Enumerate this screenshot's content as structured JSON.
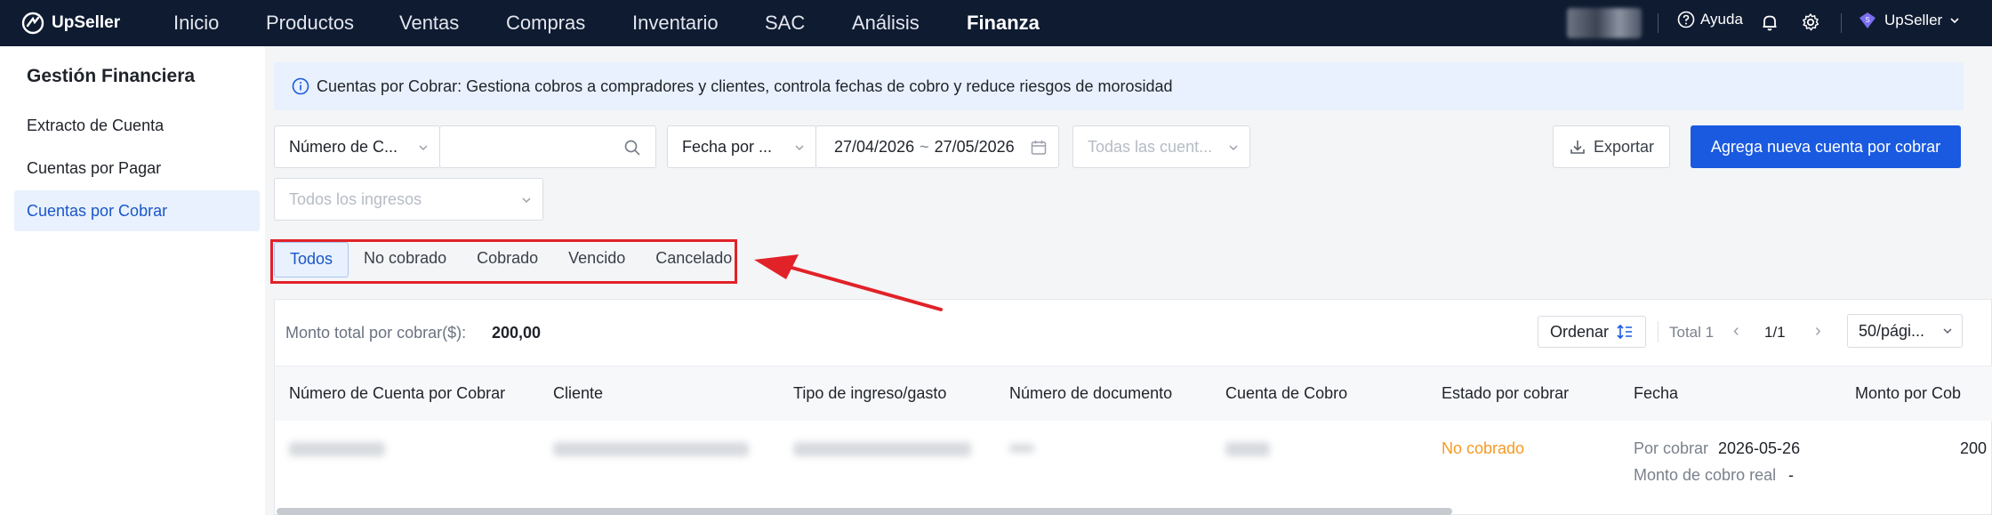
{
  "app": {
    "name": "UpSeller"
  },
  "nav": {
    "items": [
      "Inicio",
      "Productos",
      "Ventas",
      "Compras",
      "Inventario",
      "SAC",
      "Análisis",
      "Finanza"
    ],
    "active": "Finanza",
    "help_label": "Ayuda",
    "user_label": "UpSeller"
  },
  "sidebar": {
    "title": "Gestión Financiera",
    "items": [
      "Extracto de Cuenta",
      "Cuentas por Pagar",
      "Cuentas por Cobrar"
    ],
    "active": "Cuentas por Cobrar"
  },
  "banner": {
    "text": "Cuentas por Cobrar: Gestiona cobros a compradores y clientes, controla fechas de cobro y reduce riesgos de morosidad"
  },
  "filters": {
    "search_type": "Número de C...",
    "search_value": "",
    "date_type": "Fecha por ...",
    "date_start": "27/04/2026",
    "date_sep": "~",
    "date_end": "27/05/2026",
    "accounts_placeholder": "Todas las cuent...",
    "income_placeholder": "Todos los ingresos"
  },
  "actions": {
    "export": "Exportar",
    "add": "Agrega nueva cuenta por cobrar"
  },
  "tabs": [
    "Todos",
    "No cobrado",
    "Cobrado",
    "Vencido",
    "Cancelado"
  ],
  "tabs_active": "Todos",
  "summary": {
    "label": "Monto total por cobrar($):",
    "value": "200,00"
  },
  "toolbar": {
    "sort_label": "Ordenar",
    "total": "Total 1",
    "page": "1/1",
    "page_size": "50/pági..."
  },
  "table": {
    "columns": [
      "Número de Cuenta por Cobrar",
      "Cliente",
      "Tipo de ingreso/gasto",
      "Número de documento",
      "Cuenta de Cobro",
      "Estado por cobrar",
      "Fecha",
      "Monto por Cob"
    ],
    "rows": [
      {
        "status": "No cobrado",
        "date_label": "Por cobrar",
        "date_value": "2026-05-26",
        "real_label": "Monto de cobro real",
        "real_value": "-",
        "amount": "200"
      }
    ]
  },
  "colors": {
    "nav_bg": "#0f1b31",
    "accent": "#1a5ae0",
    "status_orange": "#f59a23",
    "highlight_red": "#e12228"
  }
}
